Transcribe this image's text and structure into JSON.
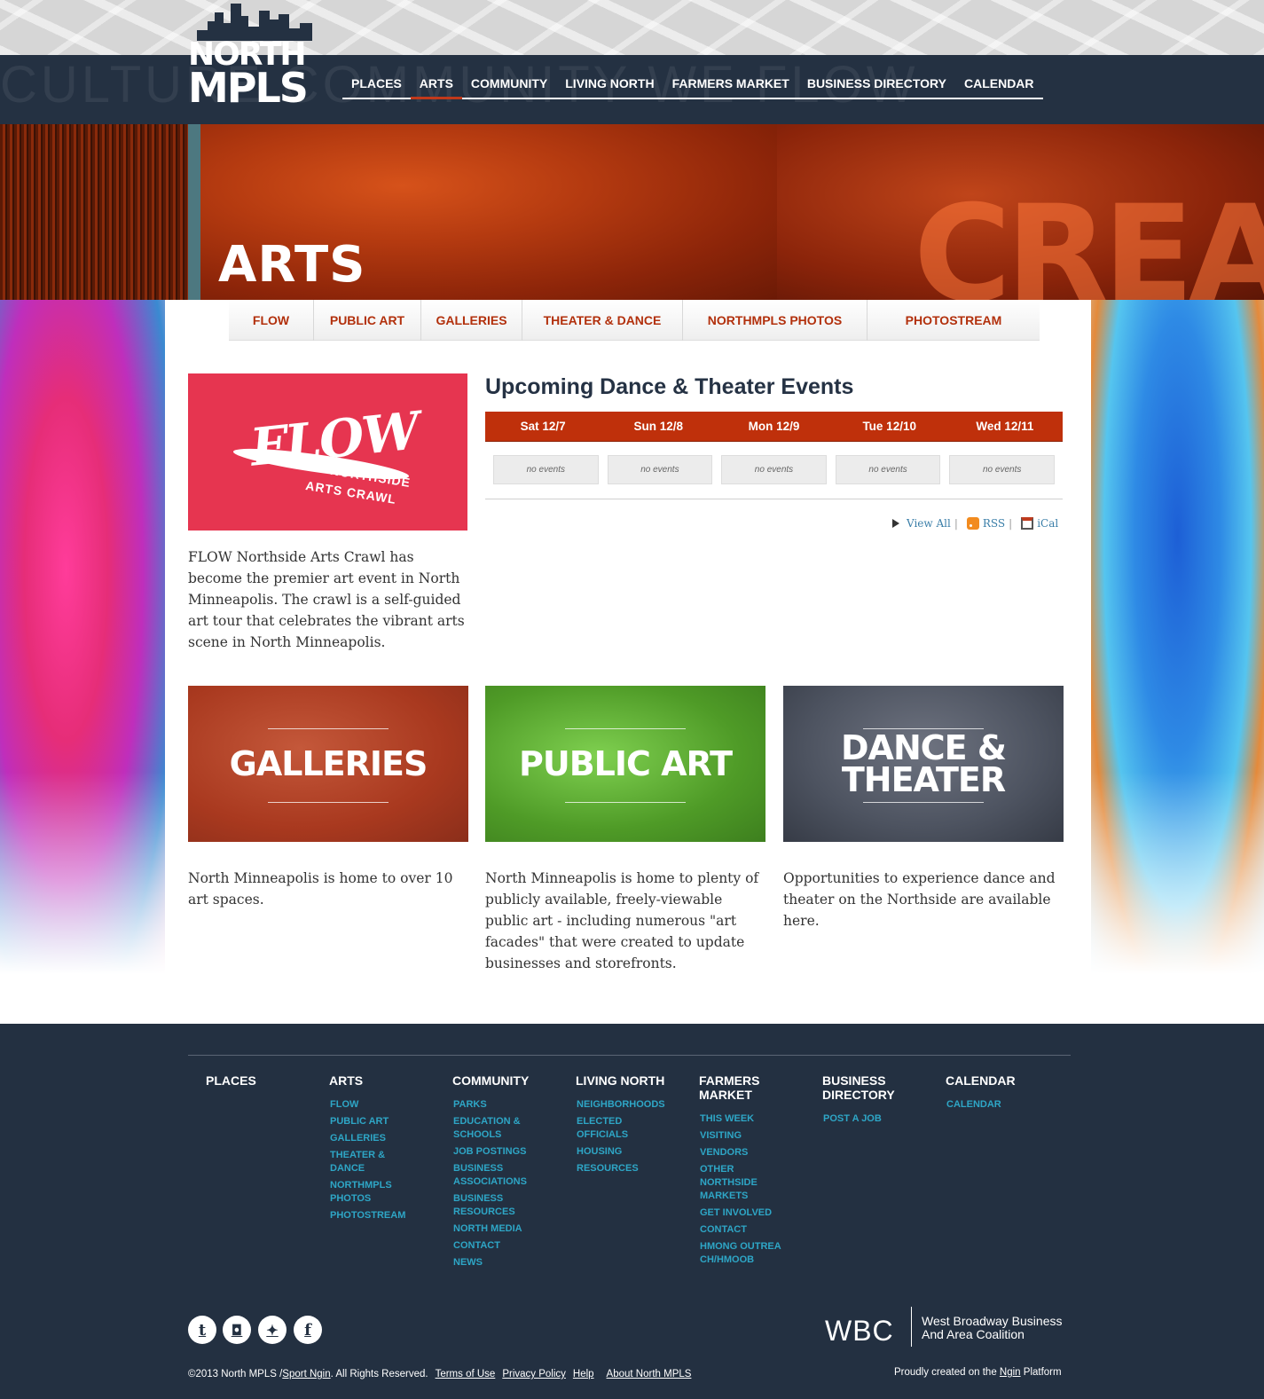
{
  "header": {
    "logo_line1": "NORTH",
    "logo_line2": "MPLS",
    "ghost_words": "CULTURE  COMMUNITY  WE FLOW",
    "nav": [
      "PLACES",
      "ARTS",
      "COMMUNITY",
      "LIVING NORTH",
      "FARMERS MARKET",
      "BUSINESS DIRECTORY",
      "CALENDAR"
    ],
    "active_nav": "ARTS"
  },
  "hero": {
    "title": "ARTS",
    "background_word": "CREATE"
  },
  "subnav": [
    "FLOW",
    "PUBLIC ART",
    "GALLERIES",
    "THEATER & DANCE",
    "NORTHMPLS PHOTOS",
    "PHOTOSTREAM"
  ],
  "flow": {
    "logo_word": "FLOW",
    "logo_sub1": "NORTHSIDE",
    "logo_sub2": "ARTS CRAWL",
    "text": "FLOW Northside Arts Crawl has become the premier art event in North Minneapolis. The crawl is a self-guided art tour that celebrates the vibrant arts scene in North Minneapolis."
  },
  "events": {
    "title": "Upcoming Dance & Theater Events",
    "days": [
      "Sat 12/7",
      "Sun 12/8",
      "Mon 12/9",
      "Tue 12/10",
      "Wed 12/11"
    ],
    "no_events": "no events",
    "view_all": "View All",
    "rss": "RSS",
    "ical": "iCal"
  },
  "tiles": [
    {
      "title_line1": "GALLERIES",
      "title_line2": "",
      "text": "North Minneapolis is home to over 10 art spaces."
    },
    {
      "title_line1": "PUBLIC ART",
      "title_line2": "",
      "text": "North Minneapolis is home to plenty of publicly available, freely-viewable public art - including numerous \"art facades\" that were created to update businesses and storefronts."
    },
    {
      "title_line1": "DANCE &",
      "title_line2": "THEATER",
      "text": "Opportunities to experience dance and theater on the Northside are available here."
    }
  ],
  "footer": {
    "columns": [
      {
        "title": "PLACES",
        "links": []
      },
      {
        "title": "ARTS",
        "links": [
          "FLOW",
          "PUBLIC ART",
          "GALLERIES",
          "THEATER & DANCE",
          "NORTHMPLS PHOTOS",
          "PHOTOSTREAM"
        ]
      },
      {
        "title": "COMMUNITY",
        "links": [
          "PARKS",
          "EDUCATION & SCHOOLS",
          "JOB POSTINGS",
          "BUSINESS ASSOCIATIONS",
          "BUSINESS RESOURCES",
          "NORTH MEDIA",
          "CONTACT",
          "NEWS"
        ]
      },
      {
        "title": "LIVING NORTH",
        "links": [
          "NEIGHBORHOODS",
          "ELECTED OFFICIALS",
          "HOUSING",
          "RESOURCES"
        ]
      },
      {
        "title": "FARMERS MARKET",
        "links": [
          "THIS WEEK",
          "VISITING",
          "VENDORS",
          "OTHER NORTHSIDE MARKETS",
          "GET INVOLVED",
          "CONTACT",
          "HMONG OUTREACH/HMOOB"
        ]
      },
      {
        "title": "BUSINESS DIRECTORY",
        "links": [
          "POST A JOB"
        ]
      },
      {
        "title": "CALENDAR",
        "links": [
          "CALENDAR"
        ]
      }
    ],
    "social_icons": [
      "tumblr-icon",
      "instagram-icon",
      "twitter-icon",
      "facebook-icon"
    ],
    "social_glyphs": [
      "t",
      "◘",
      "✦",
      "f"
    ],
    "wbc_logo": "WBC",
    "wbc_name_line1": "West Broadway Business",
    "wbc_name_line2": "And Area Coalition",
    "copyright_prefix": "©2013 North MPLS / ",
    "sport_ngin": "Sport Ngin",
    "rights": ". All Rights Reserved.",
    "legal_links": [
      "Terms of Use",
      "Privacy Policy",
      "Help",
      "About North MPLS"
    ],
    "proud_prefix": "Proudly created on the ",
    "proud_link": "Ngin",
    "proud_suffix": " Platform"
  },
  "colors": {
    "navy": "#243142",
    "accent_red": "#bf300b",
    "flow_pink": "#e63550",
    "footer_link": "#2ea6c6"
  }
}
